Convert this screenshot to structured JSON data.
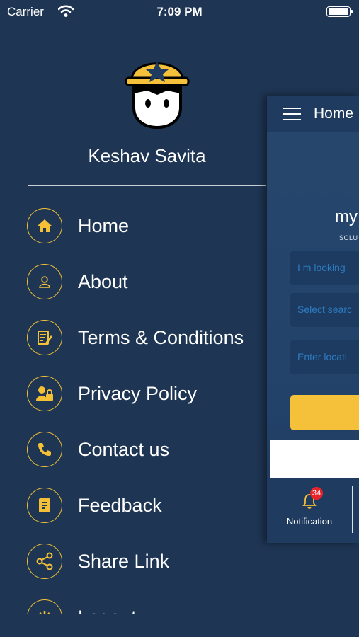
{
  "status_bar": {
    "carrier": "Carrier",
    "time": "7:09 PM"
  },
  "drawer": {
    "user_name": "Keshav Savita",
    "menu": [
      {
        "label": "Home",
        "icon": "home-icon"
      },
      {
        "label": "About",
        "icon": "user-icon"
      },
      {
        "label": "Terms & Conditions",
        "icon": "document-edit-icon"
      },
      {
        "label": "Privacy Policy",
        "icon": "user-lock-icon"
      },
      {
        "label": "Contact us",
        "icon": "phone-icon"
      },
      {
        "label": "Feedback",
        "icon": "feedback-icon"
      },
      {
        "label": "Share Link",
        "icon": "share-icon"
      },
      {
        "label": "Logout",
        "icon": "power-icon"
      }
    ]
  },
  "home_panel": {
    "title": "Home",
    "brand": "my",
    "brand_sub": "SOLU",
    "field_1_placeholder": "I m looking",
    "field_2_placeholder": "Select searc",
    "field_3_placeholder": "Enter locati",
    "notification_label": "Notification",
    "notification_count": "34"
  },
  "colors": {
    "background": "#1e3553",
    "accent": "#f4c136",
    "badge": "#e8242b"
  }
}
